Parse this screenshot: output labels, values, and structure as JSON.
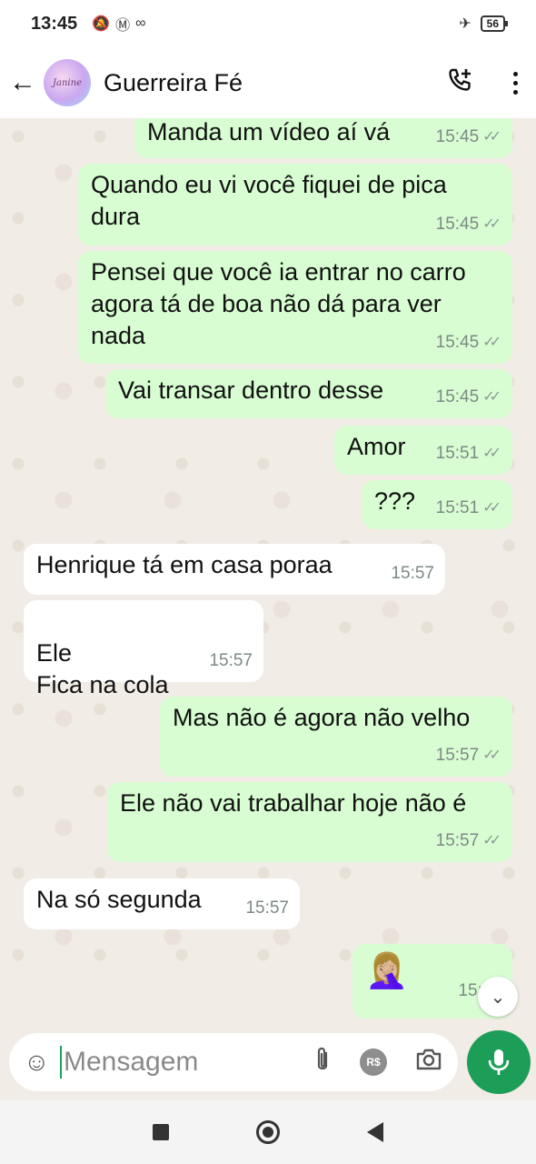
{
  "status": {
    "time": "13:45",
    "battery": "56"
  },
  "header": {
    "contact_name": "Guerreira Fé",
    "avatar_text": "Janine"
  },
  "messages": [
    {
      "dir": "out",
      "text": "Manda um vídeo aí vá",
      "time": "15:45"
    },
    {
      "dir": "out",
      "text": "Quando eu vi você fiquei de pica dura",
      "time": "15:45"
    },
    {
      "dir": "out",
      "text": "Pensei que você ia entrar no carro agora tá de boa não dá para ver nada",
      "time": "15:45"
    },
    {
      "dir": "out",
      "text": "Vai transar dentro desse",
      "time": "15:45"
    },
    {
      "dir": "out",
      "text": "Amor",
      "time": "15:51"
    },
    {
      "dir": "out",
      "text": "???",
      "time": "15:51"
    },
    {
      "dir": "in",
      "text": "Henrique tá em casa poraa",
      "time": "15:57"
    },
    {
      "dir": "in",
      "text": "Ele\nFica na cola",
      "time": "15:57"
    },
    {
      "dir": "out",
      "text": "Mas não é agora não velho",
      "time": "15:57"
    },
    {
      "dir": "out",
      "text": "Ele não vai trabalhar hoje não é",
      "time": "15:57"
    },
    {
      "dir": "in",
      "text": "Na só segunda",
      "time": "15:57"
    },
    {
      "dir": "out",
      "text": "🤦🏼‍♀️",
      "time": "15:58"
    }
  ],
  "composer": {
    "placeholder": "Mensagem",
    "rs_label": "R$"
  },
  "icons": {
    "back": "arrow-left-icon",
    "call": "add-call-icon",
    "menu": "kebab-menu-icon",
    "emoji": "emoji-icon",
    "attach": "paperclip-icon",
    "payment": "real-currency-icon",
    "camera": "camera-icon",
    "mic": "microphone-icon"
  },
  "colors": {
    "outgoing_bubble": "#d8fdd2",
    "incoming_bubble": "#ffffff",
    "accent": "#1d9e58",
    "chat_bg": "#f1ece5"
  }
}
